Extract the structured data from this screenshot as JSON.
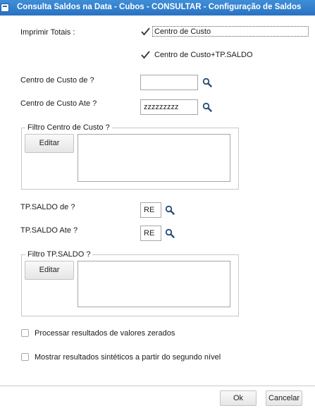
{
  "window": {
    "title": "Consulta Saldos na Data - Cubos - CONSULTAR - Configuração de Saldos"
  },
  "form": {
    "imprimir_totais_label": "Imprimir Totais :",
    "chk_centro_custo_label": "Centro de Custo",
    "chk_centro_custo_checked": true,
    "chk_centro_custo_tpsaldo_label": "Centro de Custo+TP.SALDO",
    "chk_centro_custo_tpsaldo_checked": true,
    "cc_de_label": "Centro de Custo de  ?",
    "cc_de_value": "",
    "cc_ate_label": "Centro de Custo Ate  ?",
    "cc_ate_value": "zzzzzzzzz",
    "filtro_cc_title": "Filtro Centro de Custo ?",
    "filtro_cc_button": "Editar",
    "tps_de_label": "TP.SALDO de  ?",
    "tps_de_value": "RE",
    "tps_ate_label": "TP.SALDO Ate  ?",
    "tps_ate_value": "RE",
    "filtro_tps_title": "Filtro TP.SALDO ?",
    "filtro_tps_button": "Editar",
    "chk_processar_label": "Processar resultados de valores zerados",
    "chk_processar_checked": false,
    "chk_mostrar_label": "Mostrar resultados sintéticos a partir do segundo nível",
    "chk_mostrar_checked": false
  },
  "footer": {
    "ok_label": "Ok",
    "cancel_label": "Cancelar"
  }
}
